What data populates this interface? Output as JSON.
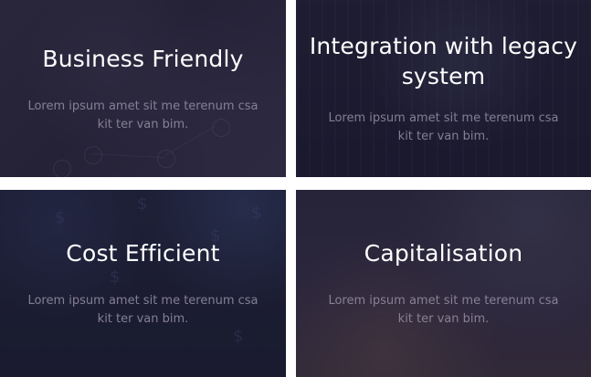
{
  "cards": [
    {
      "title": "Business Friendly",
      "text": "Lorem ipsum amet sit me terenum csa kit ter van bim."
    },
    {
      "title": "Integration with legacy system",
      "text": "Lorem ipsum amet sit me terenum csa kit ter van bim."
    },
    {
      "title": "Cost Efficient",
      "text": "Lorem ipsum amet sit me terenum csa kit ter van bim."
    },
    {
      "title": "Capitalisation",
      "text": "Lorem ipsum amet sit me terenum csa kit ter van bim."
    }
  ],
  "colors": {
    "overlay": "#221e38",
    "title": "#ffffff",
    "body_text": "#9691a5"
  },
  "icons": {
    "card_1_background": "network-people-image",
    "card_2_background": "code-matrix-image",
    "card_3_background": "dollar-signs-image",
    "card_4_background": "banknotes-calculator-image"
  }
}
